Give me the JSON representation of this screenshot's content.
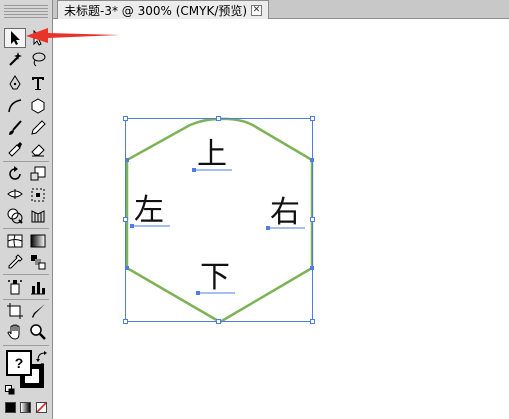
{
  "document": {
    "tab_title": "未标题-3* @ 300% (CMYK/预览)",
    "close_glyph": "✕"
  },
  "artwork": {
    "labels": {
      "top": "上",
      "left": "左",
      "right": "右",
      "bottom": "下"
    },
    "path_color": "#7db255",
    "selection_color": "#4f7de0"
  },
  "toolbox": {
    "tools": [
      "selection-tool",
      "direct-selection-tool",
      "magic-wand-tool",
      "lasso-tool",
      "pen-tool",
      "type-tool",
      "line-segment-tool",
      "polygon-tool",
      "paintbrush-tool",
      "pencil-tool",
      "blob-brush-tool",
      "eraser-tool",
      "rotate-tool",
      "scale-tool",
      "width-tool",
      "free-transform-tool",
      "shape-builder-tool",
      "perspective-grid-tool",
      "mesh-tool",
      "gradient-tool",
      "eyedropper-tool",
      "blend-tool",
      "symbol-sprayer-tool",
      "column-graph-tool",
      "artboard-tool",
      "slice-tool",
      "hand-tool",
      "zoom-tool"
    ],
    "fill_stroke_help": "?",
    "swap_icon": "swap-fill-stroke-icon",
    "mode_icons": [
      "color-mode-icon",
      "gradient-mode-icon",
      "none-mode-icon"
    ]
  },
  "annotation": {
    "color": "#e8332b"
  }
}
